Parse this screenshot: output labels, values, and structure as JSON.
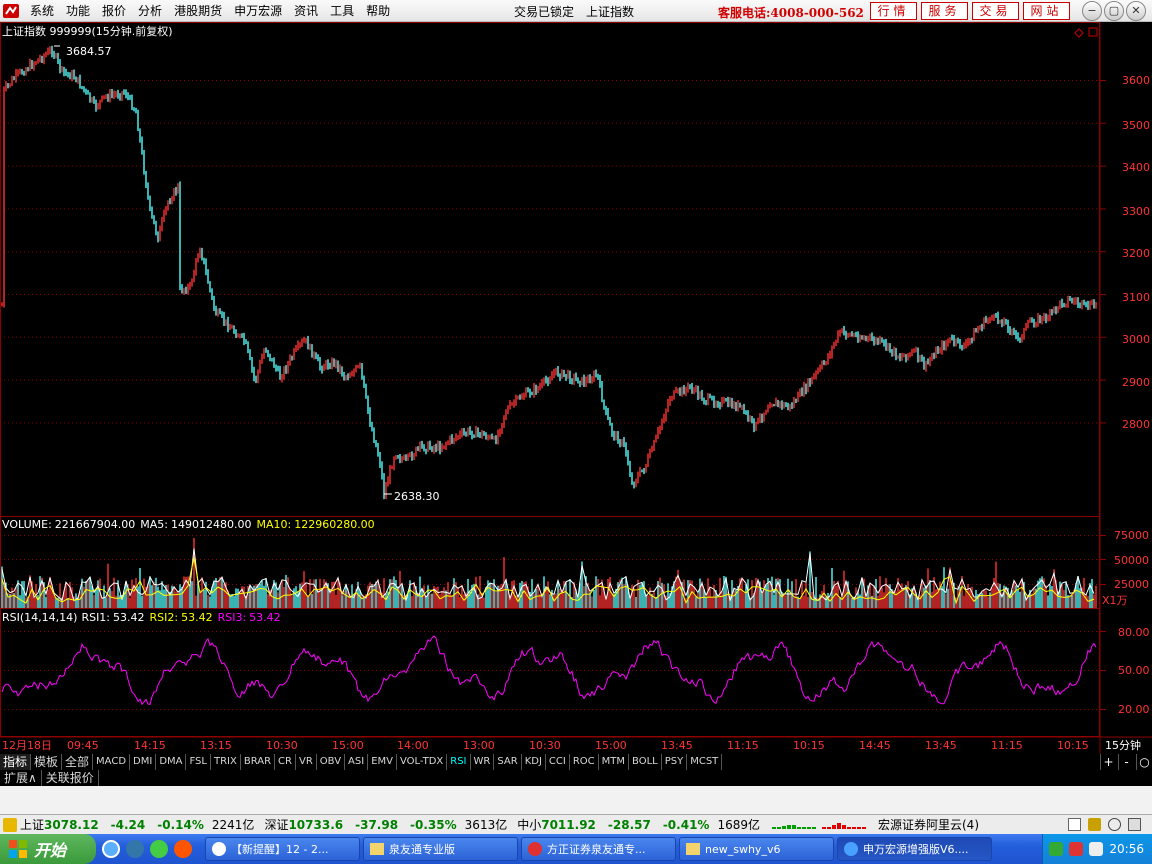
{
  "menubar": {
    "items": [
      "系统",
      "功能",
      "报价",
      "分析",
      "港股期货",
      "申万宏源",
      "资讯",
      "工具",
      "帮助"
    ],
    "status_items": [
      "交易已锁定",
      "上证指数"
    ],
    "hotline": "客服电话:4008-000-562",
    "quick_buttons": [
      "行情",
      "服务",
      "交易",
      "网站"
    ],
    "window_buttons": [
      "−",
      "▢",
      "✕"
    ]
  },
  "chart": {
    "title": "上证指数 999999(15分钟.前复权)",
    "high_label": "3684.57",
    "low_label": "2638.30",
    "price_axis": [
      "3600",
      "3500",
      "3400",
      "3300",
      "3200",
      "3100",
      "3000",
      "2900",
      "2800"
    ],
    "volume": {
      "label": "VOLUME:",
      "value": "221667904.00",
      "ma5_label": "MA5:",
      "ma5_value": "149012480.00",
      "ma10_label": "MA10:",
      "ma10_value": "122960280.00",
      "axis": [
        "75000",
        "50000",
        "25000"
      ],
      "unit": "X1万"
    },
    "rsi": {
      "label": "RSI(14,14,14)",
      "rsi1_label": "RSI1:",
      "rsi1_value": "53.42",
      "rsi2_label": "RSI2:",
      "rsi2_value": "53.42",
      "rsi3_label": "RSI3:",
      "rsi3_value": "53.42",
      "axis": [
        "80.00",
        "50.00",
        "20.00"
      ]
    },
    "time_axis": [
      "12月18日",
      "09:45",
      "14:15",
      "13:15",
      "10:30",
      "15:00",
      "14:00",
      "13:00",
      "10:30",
      "15:00",
      "13:45",
      "11:15",
      "10:15",
      "14:45",
      "13:45",
      "11:15",
      "10:15"
    ],
    "period": "15分钟"
  },
  "colors": {
    "up": "#ff3333",
    "down": "#54ffff",
    "grid": "#8c0000",
    "ma5": "#ffffff",
    "ma10": "#ffff00",
    "rsi": "#ff00ff"
  },
  "indicator_tabs": [
    "指标",
    "模板",
    "全部",
    "MACD",
    "DMI",
    "DMA",
    "FSL",
    "TRIX",
    "BRAR",
    "CR",
    "VR",
    "OBV",
    "ASI",
    "EMV",
    "VOL-TDX",
    "RSI",
    "WR",
    "SAR",
    "KDJ",
    "CCI",
    "ROC",
    "MTM",
    "BOLL",
    "PSY",
    "MCST"
  ],
  "tab_controls": [
    "+",
    "-",
    "○"
  ],
  "sub_tabs": [
    "扩展∧",
    "关联报价"
  ],
  "status_bar": {
    "sh_label": "上证",
    "sh_value": "3078.12",
    "sh_change": "-4.24",
    "sh_pct": "-0.14%",
    "sh_amount": "2241亿",
    "sz_label": "深证",
    "sz_value": "10733.6",
    "sz_change": "-37.98",
    "sz_pct": "-0.35%",
    "sz_amount": "3613亿",
    "zx_label": "中小",
    "zx_value": "7011.92",
    "zx_change": "-28.57",
    "zx_pct": "-0.41%",
    "zx_amount": "1689亿",
    "broker": "宏源证券阿里云(4)"
  },
  "taskbar": {
    "start": "开始",
    "items": [
      "【新提醒】12 - 2...",
      "泉友通专业版",
      "方正证券泉友通专...",
      "new_swhy_v6",
      "申万宏源增强版V6...."
    ],
    "clock": "20:56"
  }
}
